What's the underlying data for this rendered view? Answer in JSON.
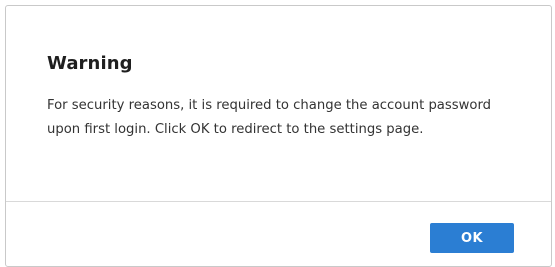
{
  "dialog": {
    "title": "Warning",
    "message": "For security reasons, it is required to change the account password upon first login. Click OK to redirect to the settings page.",
    "ok_label": "OK"
  },
  "colors": {
    "accent": "#2b7ed3",
    "border": "#c9c9c9",
    "divider": "#d9d9d9"
  }
}
